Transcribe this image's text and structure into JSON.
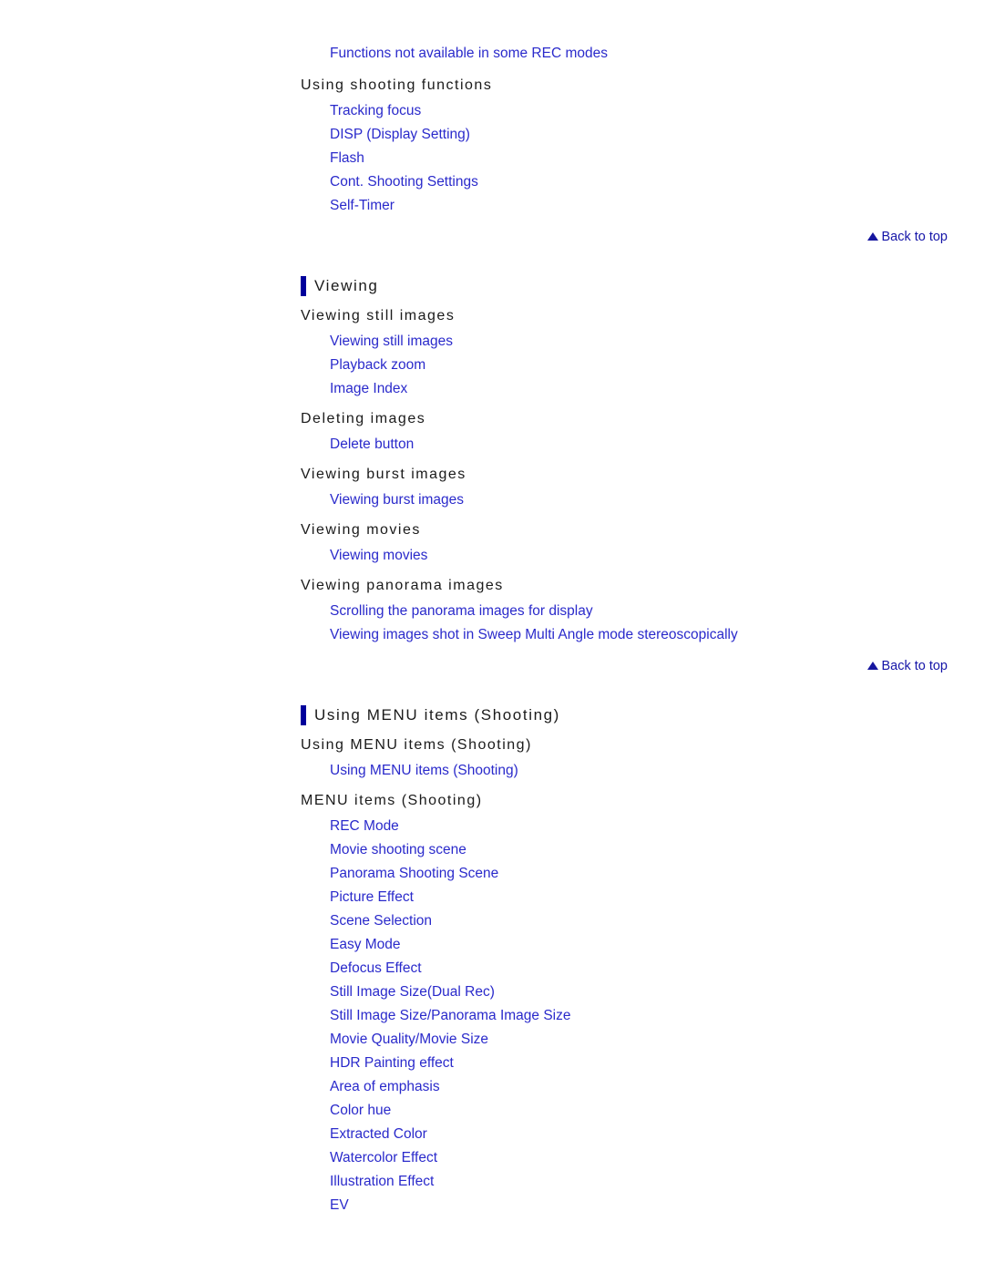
{
  "page": {
    "background_color": "#ffffff",
    "link_color": "#2A2ACB",
    "heading_color": "#1a1a1a",
    "accent_bar_color": "#00009B",
    "back_to_top_color": "#1515A8"
  },
  "top_orphan": {
    "links": [
      "Functions not available in some REC modes"
    ]
  },
  "groups_before_first_rule": [
    {
      "sub_heading": "Using shooting functions",
      "links": [
        "Tracking focus",
        "DISP (Display Setting)",
        "Flash",
        "Cont. Shooting Settings",
        "Self-Timer"
      ]
    }
  ],
  "back_to_top_1": {
    "label": "Back to top",
    "icon": "triangle-up-icon"
  },
  "sections": [
    {
      "title": "Viewing",
      "groups": [
        {
          "sub_heading": "Viewing still images",
          "links": [
            "Viewing still images",
            "Playback zoom",
            "Image Index"
          ]
        },
        {
          "sub_heading": "Deleting images",
          "links": [
            "Delete button"
          ]
        },
        {
          "sub_heading": "Viewing burst images",
          "links": [
            "Viewing burst images"
          ]
        },
        {
          "sub_heading": "Viewing movies",
          "links": [
            "Viewing movies"
          ]
        },
        {
          "sub_heading": "Viewing panorama images",
          "links": [
            "Scrolling the panorama images for display",
            "Viewing images shot in Sweep Multi Angle mode stereoscopically"
          ]
        }
      ],
      "back_to_top": {
        "label": "Back to top",
        "icon": "triangle-up-icon"
      }
    },
    {
      "title": "Using MENU items (Shooting)",
      "groups": [
        {
          "sub_heading": "Using MENU items (Shooting)",
          "links": [
            "Using MENU items (Shooting)"
          ]
        },
        {
          "sub_heading": "MENU items (Shooting)",
          "links": [
            "REC Mode",
            "Movie shooting scene",
            "Panorama Shooting Scene",
            "Picture Effect",
            "Scene Selection",
            "Easy Mode",
            "Defocus Effect",
            "Still Image Size(Dual Rec)",
            "Still Image Size/Panorama Image Size",
            "Movie Quality/Movie Size",
            "HDR Painting effect",
            "Area of emphasis",
            "Color hue",
            "Extracted Color",
            "Watercolor Effect",
            "Illustration Effect",
            "EV"
          ]
        }
      ],
      "back_to_top": null
    }
  ]
}
